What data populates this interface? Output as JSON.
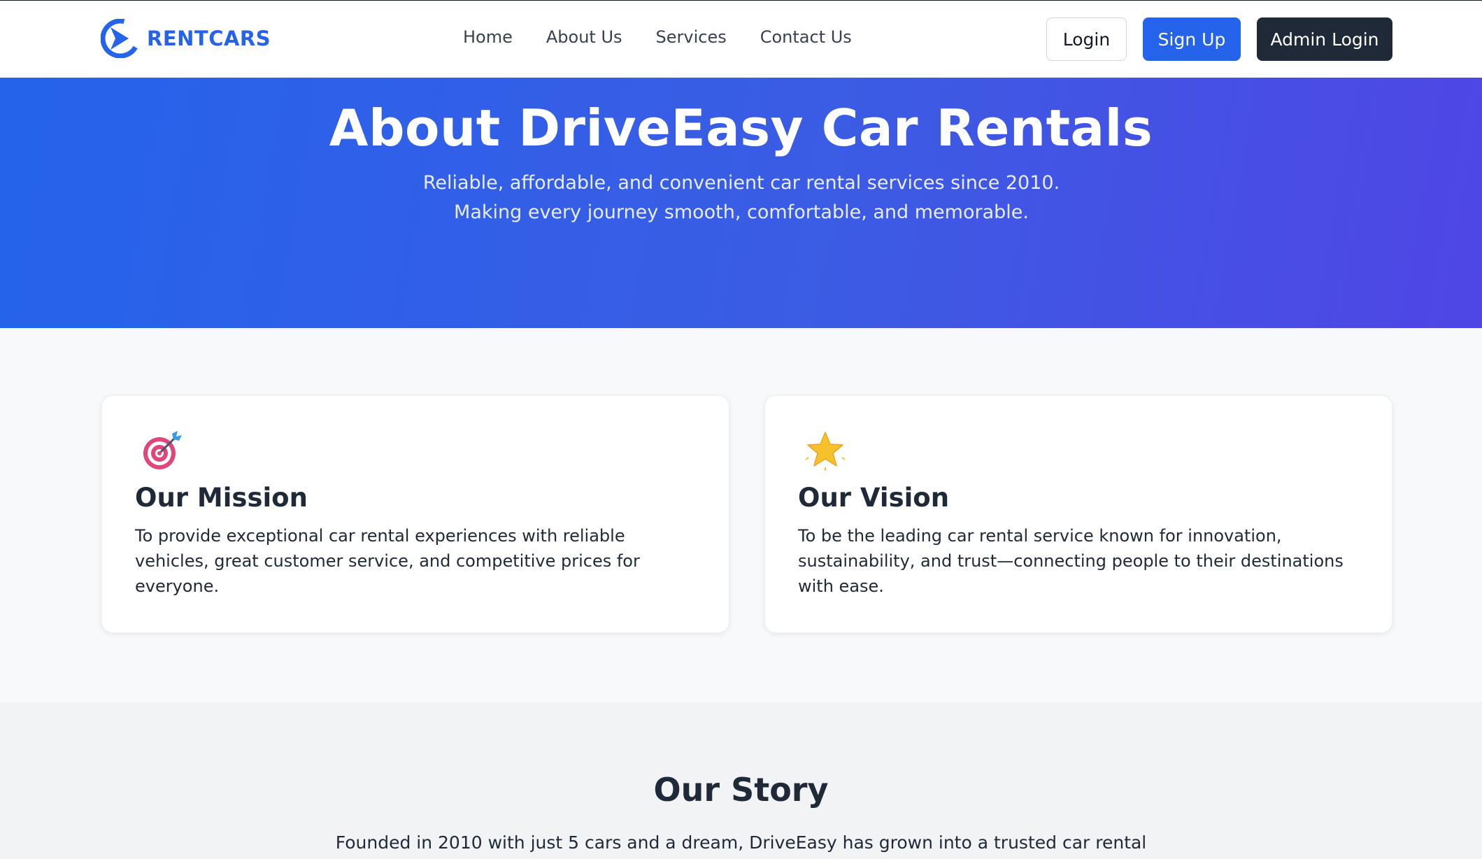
{
  "header": {
    "brand_name": "RENTCARS",
    "nav": [
      "Home",
      "About Us",
      "Services",
      "Contact Us"
    ],
    "login_label": "Login",
    "signup_label": "Sign Up",
    "admin_label": "Admin Login"
  },
  "hero": {
    "title": "About DriveEasy Car Rentals",
    "subtitle": "Reliable, affordable, and convenient car rental services since 2010. Making every journey smooth, comfortable, and memorable."
  },
  "mission": {
    "icon": "target-icon",
    "title": "Our Mission",
    "text": "To provide exceptional car rental experiences with reliable vehicles, great customer service, and competitive prices for everyone."
  },
  "vision": {
    "icon": "star-icon",
    "title": "Our Vision",
    "text": "To be the leading car rental service known for innovation, sustainability, and trust—connecting people to their destinations with ease."
  },
  "story": {
    "title": "Our Story",
    "text": "Founded in 2010 with just 5 cars and a dream, DriveEasy has grown into a trusted car rental"
  },
  "colors": {
    "brand": "#2563eb",
    "dark": "#1f2937",
    "hero_end": "#4f46e5"
  }
}
